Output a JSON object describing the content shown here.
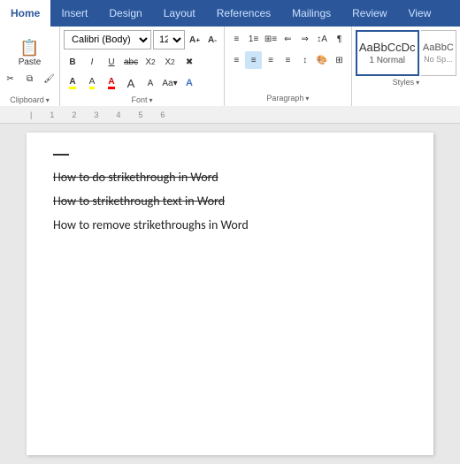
{
  "ribbon": {
    "tabs": [
      {
        "label": "Home",
        "active": true
      },
      {
        "label": "Insert",
        "active": false
      },
      {
        "label": "Design",
        "active": false
      },
      {
        "label": "Layout",
        "active": false
      },
      {
        "label": "References",
        "active": false
      },
      {
        "label": "Mailings",
        "active": false
      },
      {
        "label": "Review",
        "active": false
      },
      {
        "label": "View",
        "active": false
      }
    ],
    "clipboard": {
      "paste_label": "Paste",
      "cut_label": "Cut",
      "copy_label": "Copy",
      "format_painter_label": "Format Painter",
      "group_label": "Clipboard"
    },
    "font": {
      "family": "Calibri (Body)",
      "size": "12",
      "group_label": "Font"
    },
    "paragraph": {
      "group_label": "Paragraph"
    },
    "styles": {
      "normal_label": "1 Normal",
      "normal_display": "AaBbCcDc",
      "nosp_label": "No Sp...",
      "nosp_display": "AaBbC",
      "group_label": "Styles"
    }
  },
  "document": {
    "lines": [
      {
        "text": "How to do strikethrough in Word",
        "strikethrough": true
      },
      {
        "text": "How to strikethrough text in Word",
        "strikethrough": true
      },
      {
        "text": "How to remove strikethroughs in Word",
        "strikethrough": false
      }
    ]
  },
  "cursor": {
    "visible": true
  }
}
